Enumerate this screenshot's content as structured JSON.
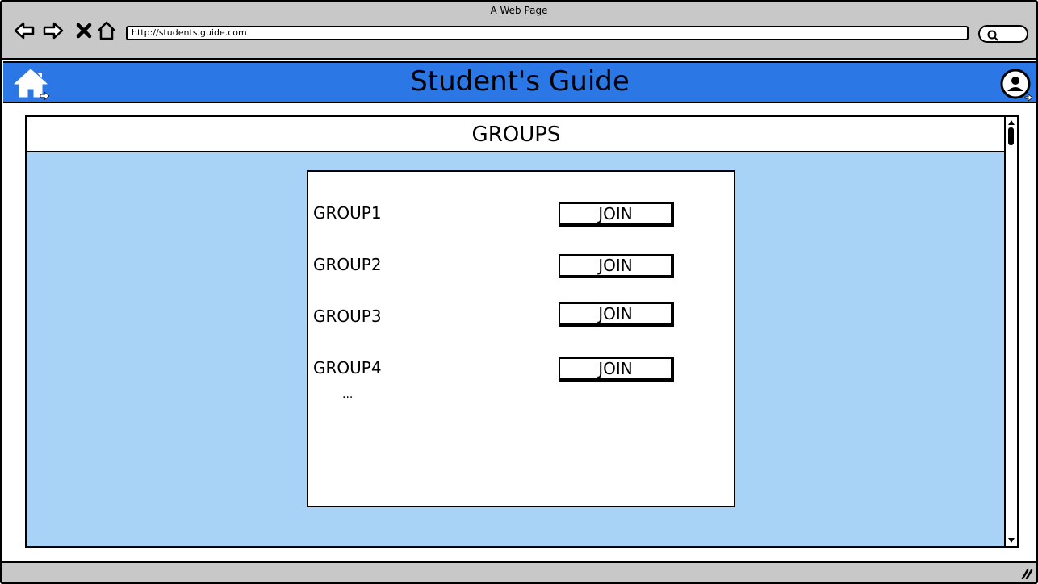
{
  "browser": {
    "window_title": "A Web Page",
    "url": "http://students.guide.com",
    "icons": [
      "back-arrow-icon",
      "forward-arrow-icon",
      "stop-icon",
      "home-icon",
      "search-icon"
    ]
  },
  "app": {
    "title": "Student's Guide",
    "header_color": "#2b77e6",
    "icons": [
      "home-icon",
      "user-profile-icon"
    ]
  },
  "panel": {
    "title": "GROUPS",
    "background_color": "#a9d3f6",
    "groups": [
      {
        "name": "GROUP1",
        "action_label": "JOIN"
      },
      {
        "name": "GROUP2",
        "action_label": "JOIN"
      },
      {
        "name": "GROUP3",
        "action_label": "JOIN"
      },
      {
        "name": "GROUP4",
        "action_label": "JOIN"
      }
    ],
    "more_indicator": "..."
  }
}
